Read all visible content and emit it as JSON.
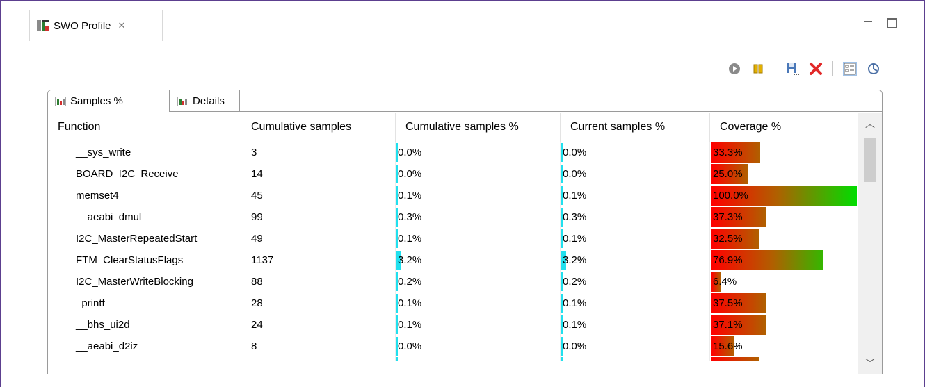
{
  "view": {
    "title": "SWO Profile",
    "close_glyph": "✕"
  },
  "toolbar": {
    "buttons": [
      "start-icon",
      "pause-icon",
      "save-icon",
      "delete-icon",
      "layout-icon",
      "refresh-icon"
    ],
    "colors": {
      "start": "#888888",
      "pause": "#e3b000",
      "save": "#4a78b8",
      "delete": "#e22828"
    }
  },
  "tabs": [
    {
      "label": "Samples %"
    },
    {
      "label": "Details"
    }
  ],
  "table": {
    "headers": [
      "Function",
      "Cumulative samples",
      "Cumulative samples %",
      "Current samples %",
      "Coverage %"
    ],
    "rows": [
      {
        "function": "__sys_write",
        "cum": "3",
        "cum_pct": "0.0%",
        "cum_val": 0.0,
        "cur_pct": "0.0%",
        "cur_val": 0.0,
        "coverage": "33.3%",
        "cov_val": 33.3
      },
      {
        "function": "BOARD_I2C_Receive",
        "cum": "14",
        "cum_pct": "0.0%",
        "cum_val": 0.0,
        "cur_pct": "0.0%",
        "cur_val": 0.0,
        "coverage": "25.0%",
        "cov_val": 25.0
      },
      {
        "function": "memset4",
        "cum": "45",
        "cum_pct": "0.1%",
        "cum_val": 0.1,
        "cur_pct": "0.1%",
        "cur_val": 0.1,
        "coverage": "100.0%",
        "cov_val": 100.0
      },
      {
        "function": "__aeabi_dmul",
        "cum": "99",
        "cum_pct": "0.3%",
        "cum_val": 0.3,
        "cur_pct": "0.3%",
        "cur_val": 0.3,
        "coverage": "37.3%",
        "cov_val": 37.3
      },
      {
        "function": "I2C_MasterRepeatedStart",
        "cum": "49",
        "cum_pct": "0.1%",
        "cum_val": 0.1,
        "cur_pct": "0.1%",
        "cur_val": 0.1,
        "coverage": "32.5%",
        "cov_val": 32.5
      },
      {
        "function": "FTM_ClearStatusFlags",
        "cum": "1137",
        "cum_pct": "3.2%",
        "cum_val": 3.2,
        "cur_pct": "3.2%",
        "cur_val": 3.2,
        "coverage": "76.9%",
        "cov_val": 76.9
      },
      {
        "function": "I2C_MasterWriteBlocking",
        "cum": "88",
        "cum_pct": "0.2%",
        "cum_val": 0.2,
        "cur_pct": "0.2%",
        "cur_val": 0.2,
        "coverage": "6.4%",
        "cov_val": 6.4
      },
      {
        "function": "_printf",
        "cum": "28",
        "cum_pct": "0.1%",
        "cum_val": 0.1,
        "cur_pct": "0.1%",
        "cur_val": 0.1,
        "coverage": "37.5%",
        "cov_val": 37.5
      },
      {
        "function": "__bhs_ui2d",
        "cum": "24",
        "cum_pct": "0.1%",
        "cum_val": 0.1,
        "cur_pct": "0.1%",
        "cur_val": 0.1,
        "coverage": "37.1%",
        "cov_val": 37.1
      },
      {
        "function": "__aeabi_d2iz",
        "cum": "8",
        "cum_pct": "0.0%",
        "cum_val": 0.0,
        "cur_pct": "0.0%",
        "cur_val": 0.0,
        "coverage": "15.6%",
        "cov_val": 15.6
      }
    ]
  },
  "colors": {
    "accent_frame": "#5c3f8f",
    "sample_bar": "#21e0ee",
    "coverage_low": "#ff0000",
    "coverage_mid": "#b06000",
    "coverage_high": "#00dd00"
  }
}
